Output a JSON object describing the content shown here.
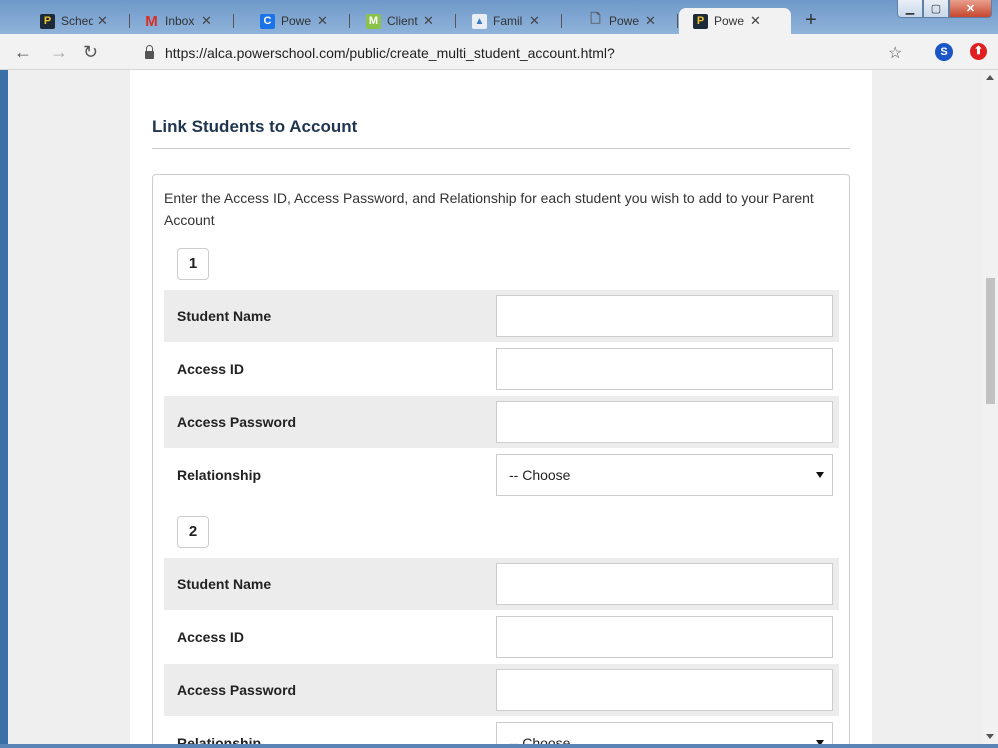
{
  "browser": {
    "tabs": [
      {
        "title": "Sched",
        "favicon": "P",
        "favicon_bg": "#1c2a3a",
        "favicon_fg": "#f2c32a",
        "active": false
      },
      {
        "title": "Inbox",
        "favicon": "M",
        "favicon_bg": "transparent",
        "favicon_fg": "#d93025",
        "active": false
      },
      {
        "title": "Powe",
        "favicon": "C",
        "favicon_bg": "#1a73e8",
        "favicon_fg": "#ffffff",
        "active": false
      },
      {
        "title": "Client",
        "favicon": "M",
        "favicon_bg": "#8bc34a",
        "favicon_fg": "#ffffff",
        "active": false
      },
      {
        "title": "Famil",
        "favicon": "▲",
        "favicon_bg": "#e8eef4",
        "favicon_fg": "#3a7abf",
        "active": false
      },
      {
        "title": "Powe",
        "favicon": "🗋",
        "favicon_bg": "transparent",
        "favicon_fg": "#555555",
        "active": false
      },
      {
        "title": "Powe",
        "favicon": "P",
        "favicon_bg": "#1c2a3a",
        "favicon_fg": "#f2c32a",
        "active": true
      }
    ],
    "close_glyph": "✕",
    "new_tab_glyph": "+",
    "url": "https://alca.powerschool.com/public/create_multi_student_account.html?",
    "extension_s_label": "S",
    "extension_o_label": "⬆"
  },
  "page": {
    "title": "Link Students to Account",
    "instructions": "Enter the Access ID, Access Password, and Relationship for each student you wish to add to your Parent Account",
    "students": [
      {
        "number": "1",
        "name_label": "Student Name",
        "access_id_label": "Access ID",
        "password_label": "Access Password",
        "relationship_label": "Relationship",
        "relationship_value": "-- Choose"
      },
      {
        "number": "2",
        "name_label": "Student Name",
        "access_id_label": "Access ID",
        "password_label": "Access Password",
        "relationship_label": "Relationship",
        "relationship_value": "-- Choose"
      }
    ]
  }
}
